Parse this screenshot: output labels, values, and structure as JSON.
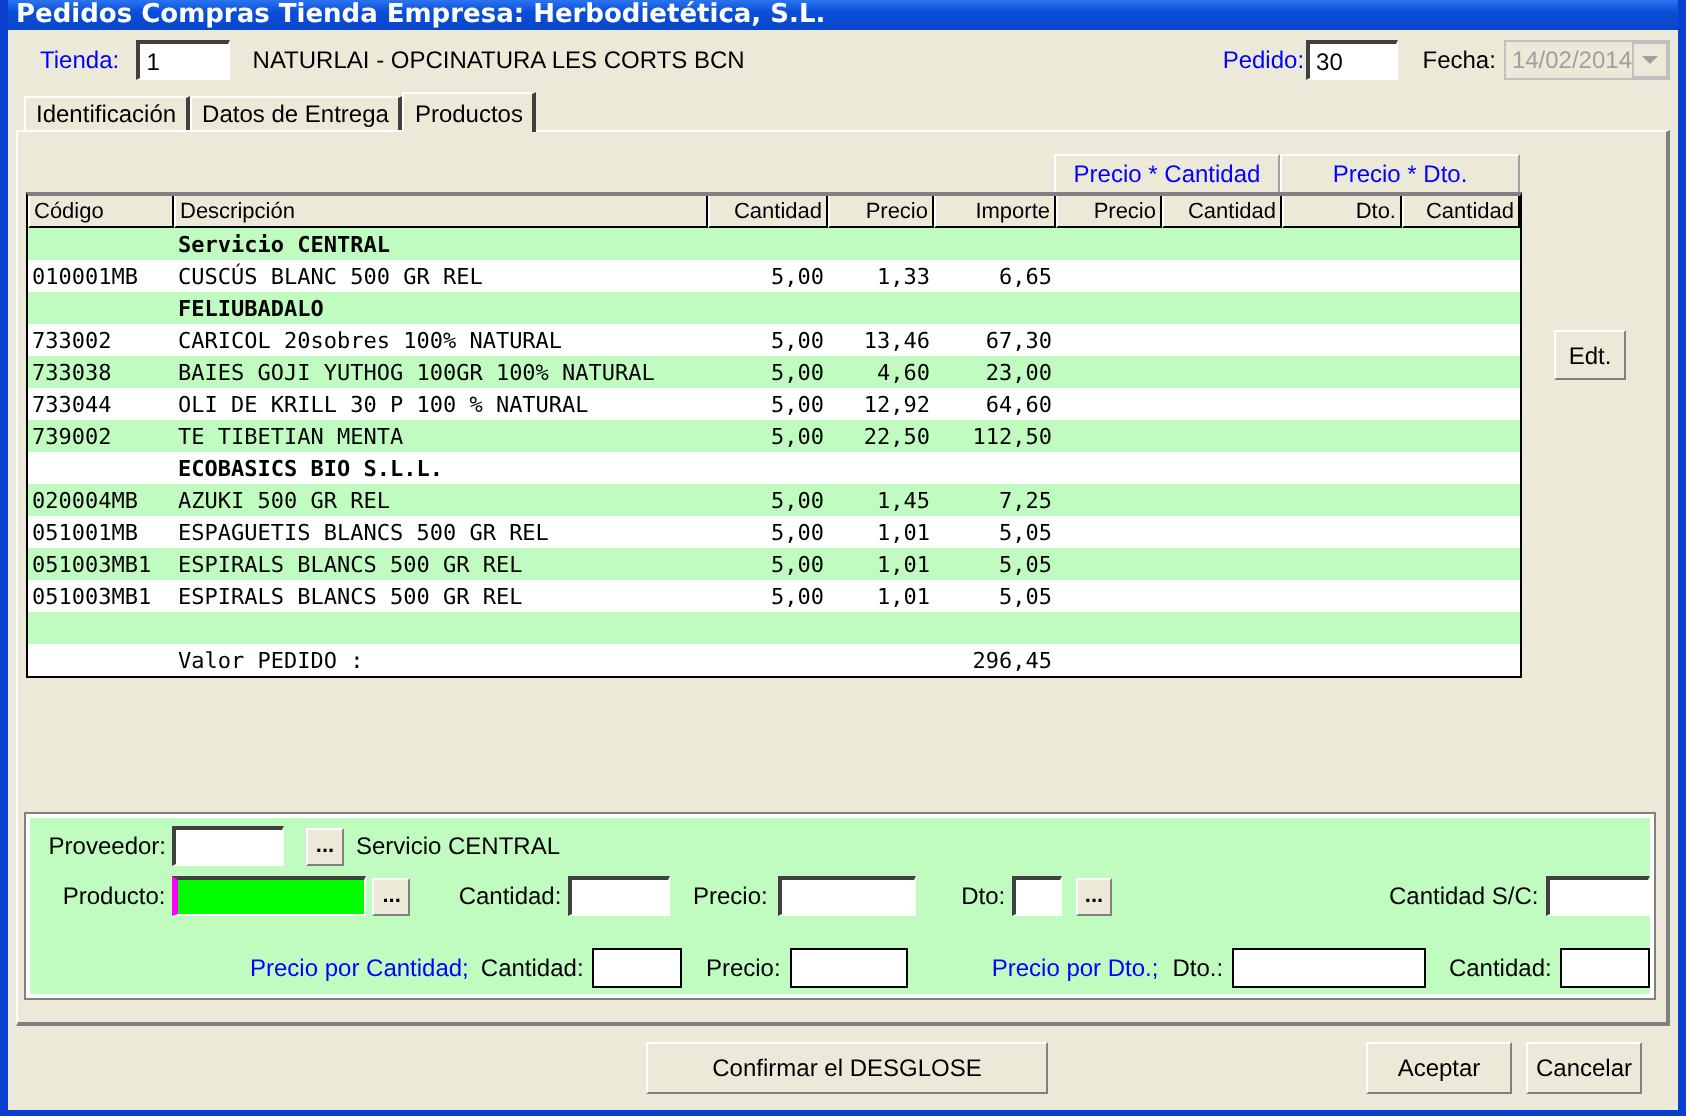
{
  "window": {
    "title": "Pedidos Compras Tienda Empresa: Herbodietética, S.L."
  },
  "header": {
    "tienda_label": "Tienda:",
    "tienda": "1",
    "tienda_name": "NATURLAI - OPCINATURA LES CORTS BCN",
    "pedido_label": "Pedido:",
    "pedido": "30",
    "fecha_label": "Fecha:",
    "fecha": "14/02/2014",
    "fecha_disabled": true
  },
  "tabs": [
    {
      "label": "Identificación",
      "selected": false
    },
    {
      "label": "Datos de Entrega",
      "selected": false
    },
    {
      "label": "Productos",
      "selected": true
    }
  ],
  "column_groups": [
    "Precio * Cantidad",
    "Precio * Dto."
  ],
  "table": {
    "columns": [
      "Código",
      "Descripción",
      "Cantidad",
      "Precio",
      "Importe",
      "Precio",
      "Cantidad",
      "Dto.",
      "Cantidad"
    ],
    "rows": [
      {
        "kind": "group",
        "label": "Servicio CENTRAL"
      },
      {
        "kind": "item",
        "code": "010001MB",
        "description": "CUSCÚS BLANC 500 GR REL",
        "cantidad": "5,00",
        "precio": "1,33",
        "importe": "6,65"
      },
      {
        "kind": "group",
        "label": "FELIUBADALO"
      },
      {
        "kind": "item",
        "code": "733002",
        "description": "CARICOL 20sobres 100% NATURAL",
        "cantidad": "5,00",
        "precio": "13,46",
        "importe": "67,30"
      },
      {
        "kind": "item",
        "code": "733038",
        "description": "BAIES GOJI YUTHOG 100GR 100% NATURAL",
        "cantidad": "5,00",
        "precio": "4,60",
        "importe": "23,00"
      },
      {
        "kind": "item",
        "code": "733044",
        "description": "OLI DE KRILL 30 P 100 % NATURAL",
        "cantidad": "5,00",
        "precio": "12,92",
        "importe": "64,60"
      },
      {
        "kind": "item",
        "code": "739002",
        "description": "TE TIBETIAN MENTA",
        "cantidad": "5,00",
        "precio": "22,50",
        "importe": "112,50"
      },
      {
        "kind": "group",
        "label": "ECOBASICS BIO S.L.L."
      },
      {
        "kind": "item",
        "code": "020004MB",
        "description": "AZUKI 500 GR REL",
        "cantidad": "5,00",
        "precio": "1,45",
        "importe": "7,25"
      },
      {
        "kind": "item",
        "code": "051001MB",
        "description": "ESPAGUETIS BLANCS 500 GR REL",
        "cantidad": "5,00",
        "precio": "1,01",
        "importe": "5,05"
      },
      {
        "kind": "item",
        "code": "051003MB1",
        "description": "ESPIRALS BLANCS 500 GR REL",
        "cantidad": "5,00",
        "precio": "1,01",
        "importe": "5,05"
      },
      {
        "kind": "item",
        "code": "051003MB1",
        "description": "ESPIRALS BLANCS 500 GR REL",
        "cantidad": "5,00",
        "precio": "1,01",
        "importe": "5,05"
      },
      {
        "kind": "blank"
      },
      {
        "kind": "total",
        "label": "Valor PEDIDO :",
        "importe": "296,45"
      }
    ]
  },
  "edit_button": "Edt.",
  "form": {
    "proveedor_label": "Proveedor:",
    "proveedor_browse": "...",
    "proveedor_name": "Servicio CENTRAL",
    "producto_label": "Producto:",
    "producto_focused": true,
    "producto_browse": "...",
    "cantidad_label": "Cantidad:",
    "precio_label": "Precio:",
    "dto_label": "Dto:",
    "dto_browse": "...",
    "cantidad_sc_label": "Cantidad S/C:",
    "ppc_label": "Precio por Cantidad;",
    "ppc_cantidad_label": "Cantidad:",
    "ppc_precio_label": "Precio:",
    "ppd_label": "Precio por Dto.;",
    "ppd_dto_label": "Dto.:",
    "ppd_cantidad_label": "Cantidad:"
  },
  "buttons": [
    "Confirmar el DESGLOSE",
    "Aceptar",
    "Cancelar"
  ]
}
